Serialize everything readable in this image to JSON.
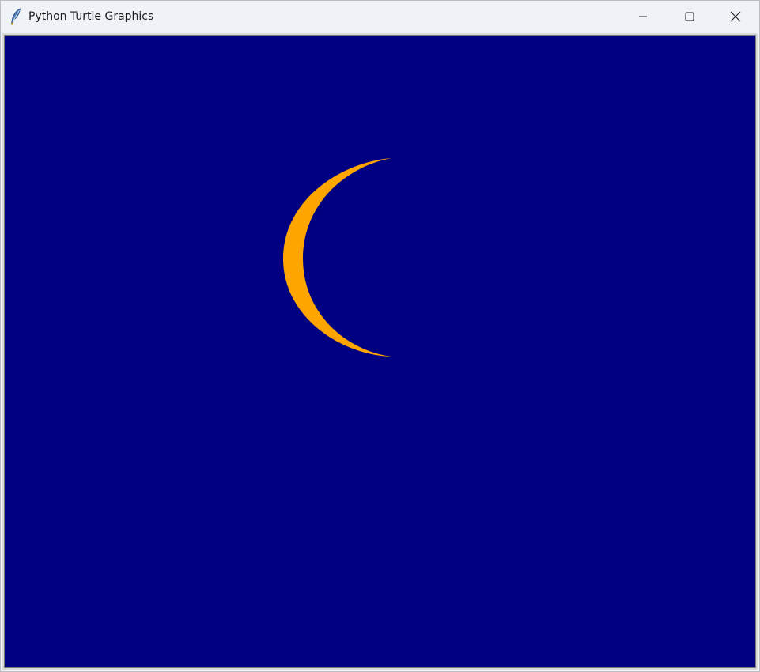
{
  "window": {
    "title": "Python Turtle Graphics",
    "icon": "feather-icon"
  },
  "controls": {
    "minimize_icon": "minimize-icon",
    "maximize_icon": "maximize-icon",
    "close_icon": "close-icon"
  },
  "canvas": {
    "background_color": "#000080",
    "shape": "crescent-moon",
    "shape_color": "#ffa500"
  }
}
